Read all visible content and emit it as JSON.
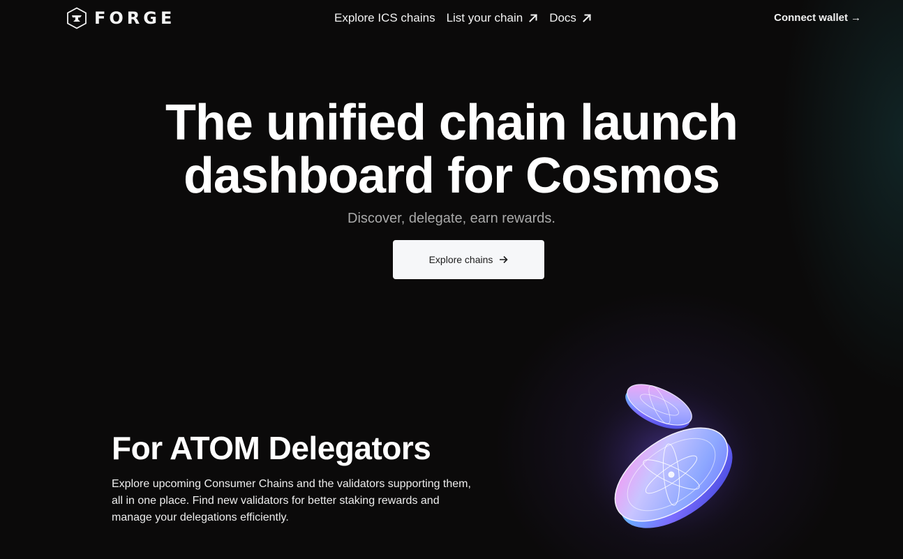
{
  "nav": {
    "brand": "FORGE",
    "links": [
      {
        "label": "Explore ICS chains",
        "external": false
      },
      {
        "label": "List your chain",
        "external": true
      },
      {
        "label": "Docs",
        "external": true
      }
    ],
    "connect_label": "Connect wallet",
    "connect_arrow": "→"
  },
  "hero": {
    "title_line1": "The unified chain launch",
    "title_line2": "dashboard for Cosmos",
    "subtitle": "Discover, delegate, earn rewards.",
    "cta_label": "Explore chains"
  },
  "section": {
    "title": "For ATOM Delegators",
    "body": "Explore upcoming Consumer Chains and the validators supporting them, all in one place. Find new validators for better staking rewards and manage your delegations efficiently."
  },
  "icons": {
    "logo": "forge-anvil-hex-icon",
    "external": "arrow-up-right-icon",
    "cta": "arrow-right-icon",
    "illustration": "atom-coins-illustration"
  },
  "colors": {
    "background": "#0b0a0a",
    "text": "#ffffff",
    "muted": "#a9a9a9",
    "button_bg": "#f6f7f9",
    "coin_cyan": "#58e3ff",
    "coin_violet": "#8a6bff",
    "coin_pink": "#ff7de9"
  }
}
